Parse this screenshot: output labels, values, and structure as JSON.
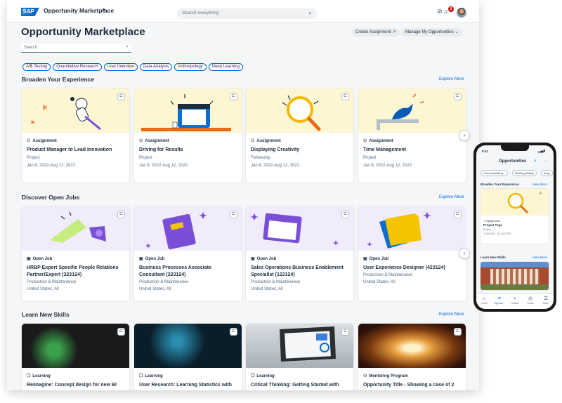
{
  "shell": {
    "logo": "SAP",
    "app_title": "Opportunity Marketplace",
    "search_placeholder": "Search everything",
    "notification_count": "2"
  },
  "header": {
    "title": "Opportunity Marketplace",
    "create_btn": "Create Assignment",
    "manage_btn": "Manage My Opportunities",
    "search_placeholder": "Search"
  },
  "chips": [
    "A/B Testing",
    "Quantitative Research",
    "User Interview",
    "Data Analysis",
    "Anthropology",
    "Deep Learning"
  ],
  "sections": {
    "experience": {
      "title": "Broaden Your Experience",
      "link": "Explore More",
      "cards": [
        {
          "type": "Assignment",
          "title": "Product Manager to Lead Innovation",
          "line1": "Project",
          "line2": "Jan 8, 2022-Aug 12, 2022"
        },
        {
          "type": "Assignment",
          "title": "Driving for Results",
          "line1": "Project",
          "line2": "Jan 8, 2022-Aug 12, 2022"
        },
        {
          "type": "Assignment",
          "title": "Displaying Creativity",
          "line1": "Fellowship",
          "line2": "Jan 8, 2022-Aug 12, 2022"
        },
        {
          "type": "Assignment",
          "title": "Time Management",
          "line1": "Project",
          "line2": "Jan 8, 2022-Aug 12, 2022"
        }
      ]
    },
    "jobs": {
      "title": "Discover Open Jobs",
      "link": "Explore More",
      "cards": [
        {
          "type": "Open Job",
          "title": "HRBP Expert Specific People Relations Partner/Expert (323124)",
          "line1": "Production & Maintenance",
          "line2": "United States, All"
        },
        {
          "type": "Open Job",
          "title": "Business Processes Associate Consultant (223124)",
          "line1": "Production & Maintenance",
          "line2": "United States, All"
        },
        {
          "type": "Open Job",
          "title": "Sales Operations Business Enablement Specialist (123124)",
          "line1": "Production & Maintenance",
          "line2": "United States, All"
        },
        {
          "type": "Open Job",
          "title": "User Experience Designer (423124)",
          "line1": "Production & Maintenance",
          "line2": "United States, All"
        }
      ]
    },
    "skills": {
      "title": "Learn New Skills",
      "link": "Explore More",
      "cards": [
        {
          "type": "Learning",
          "title": "Reimagine: Concept design for new BI"
        },
        {
          "type": "Learning",
          "title": "User Research: Learning Statistics with"
        },
        {
          "type": "Learning",
          "title": "Critical Thinking: Getting Started with"
        },
        {
          "type": "Mentoring Program",
          "title": "Opportunity Title - Showing a case of 2"
        }
      ]
    }
  },
  "phone": {
    "time": "9:41",
    "title": "Opportunities",
    "chips": [
      "Communicating...",
      "Working Safely",
      "Acqu"
    ],
    "section1": "Broaden Your Experience",
    "section1_link": "View More",
    "card_type": "Assignment",
    "card_title": "Project Toga",
    "card_line1": "Project",
    "card_line2": "1 Oct 2022 - 31 Oct 2022",
    "section2": "Learn New Skills",
    "section2_link": "View More",
    "tabs": [
      "Home",
      "Opportu...",
      "Search",
      "Goals",
      "More"
    ]
  },
  "colors": {
    "accent": "#0064d9",
    "experience_bg": "#fdf6d3",
    "jobs_bg": "#f0ecfc"
  }
}
